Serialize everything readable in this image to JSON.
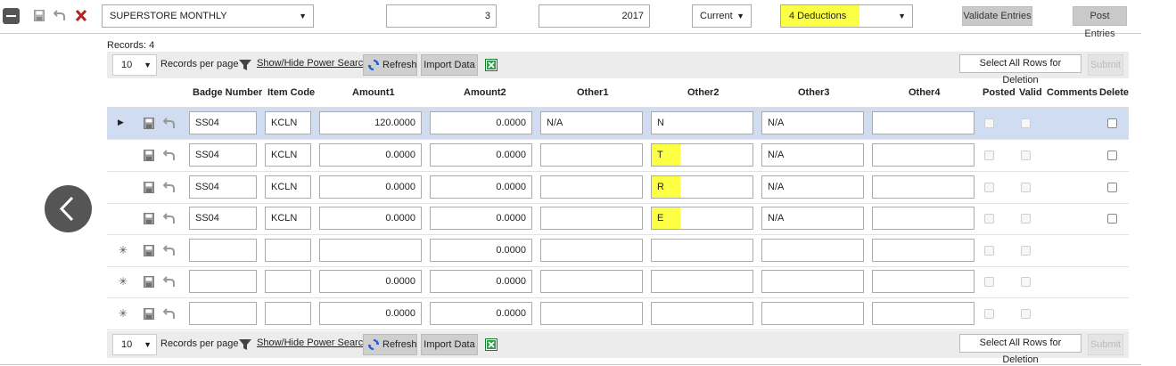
{
  "toolbar": {
    "template_select": "SUPERSTORE MONTHLY",
    "period_number": "3",
    "year": "2017",
    "period_select": "Current",
    "deductions_select": "4 Deductions",
    "validate_label": "Validate Entries",
    "post_label": "Post Entries",
    "highlight_color": "#fcff44"
  },
  "records": {
    "label": "Records:",
    "count": "4"
  },
  "pager": {
    "page_size": "10",
    "records_per_page": "Records per page",
    "power_search": "Show/Hide Power Search",
    "refresh": "Refresh",
    "import": "Import Data",
    "select_all": "Select All Rows for Deletion",
    "submit": "Submit"
  },
  "columns": [
    "Badge Number",
    "Item Code",
    "Amount1",
    "Amount2",
    "Other1",
    "Other2",
    "Other3",
    "Other4",
    "Posted",
    "Valid",
    "Comments",
    "Delete"
  ],
  "rows": [
    {
      "marker": "arrow",
      "badge": "SS04",
      "item": "KCLN",
      "amount1": "120.0000",
      "amount2": "0.0000",
      "other1": "N/A",
      "other2": "N",
      "other3": "N/A",
      "other4": "",
      "other2_highlight": false
    },
    {
      "marker": "",
      "badge": "SS04",
      "item": "KCLN",
      "amount1": "0.0000",
      "amount2": "0.0000",
      "other1": "",
      "other2": "T",
      "other3": "N/A",
      "other4": "",
      "other2_highlight": true
    },
    {
      "marker": "",
      "badge": "SS04",
      "item": "KCLN",
      "amount1": "0.0000",
      "amount2": "0.0000",
      "other1": "",
      "other2": "R",
      "other3": "N/A",
      "other4": "",
      "other2_highlight": true
    },
    {
      "marker": "",
      "badge": "SS04",
      "item": "KCLN",
      "amount1": "0.0000",
      "amount2": "0.0000",
      "other1": "",
      "other2": "E",
      "other3": "N/A",
      "other4": "",
      "other2_highlight": true
    },
    {
      "marker": "star",
      "badge": "",
      "item": "",
      "amount1": "",
      "amount2": "0.0000",
      "other1": "",
      "other2": "",
      "other3": "",
      "other4": "",
      "other2_highlight": false
    },
    {
      "marker": "star",
      "badge": "",
      "item": "",
      "amount1": "0.0000",
      "amount2": "0.0000",
      "other1": "",
      "other2": "",
      "other3": "",
      "other4": "",
      "other2_highlight": false
    },
    {
      "marker": "star",
      "badge": "",
      "item": "",
      "amount1": "0.0000",
      "amount2": "0.0000",
      "other1": "",
      "other2": "",
      "other3": "",
      "other4": "",
      "other2_highlight": false
    }
  ]
}
